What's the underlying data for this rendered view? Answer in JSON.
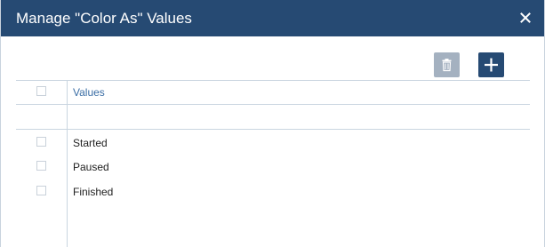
{
  "dialog": {
    "title": "Manage \"Color As\" Values",
    "close_icon": "close-icon"
  },
  "toolbar": {
    "delete_icon": "trash-icon",
    "add_icon": "plus-icon"
  },
  "table": {
    "header": "Values",
    "rows": [
      {
        "label": ""
      },
      {
        "label": "Started"
      },
      {
        "label": "Paused"
      },
      {
        "label": "Finished"
      }
    ]
  },
  "colors": {
    "titlebar": "#264a73",
    "add_button": "#264a73",
    "delete_button_disabled": "#a4b1c0",
    "header_text": "#3b6ea5",
    "grid_line": "#cad5e0"
  }
}
